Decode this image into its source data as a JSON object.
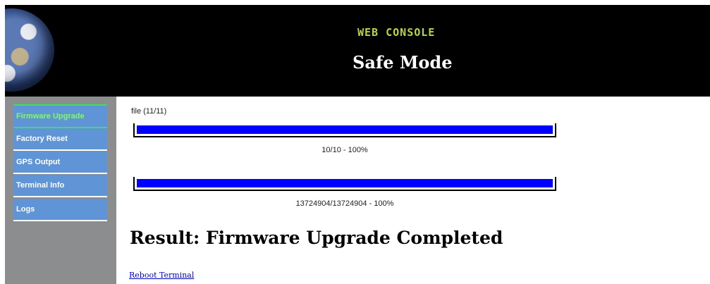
{
  "header": {
    "logo_icon": "globe-icon",
    "console_title": "WEB CONSOLE",
    "mode_title": "Safe Mode",
    "background_color": "#000000",
    "console_title_color": "#b7d63c"
  },
  "sidebar": {
    "items": [
      {
        "label": "Firmware Upgrade",
        "active": true
      },
      {
        "label": "Factory Reset",
        "active": false
      },
      {
        "label": "GPS Output",
        "active": false
      },
      {
        "label": "Terminal Info",
        "active": false
      },
      {
        "label": "Logs",
        "active": false
      }
    ],
    "item_color": "#5f95d6",
    "active_text_color": "#7cff57"
  },
  "main": {
    "file_label": "file (11/11)",
    "progress": [
      {
        "fraction": 1.0,
        "caption": "10/10 - 100%"
      },
      {
        "fraction": 1.0,
        "caption": "13724904/13724904 - 100%"
      }
    ],
    "bar_color": "#0000ff",
    "result": "Result: Firmware Upgrade Completed",
    "reboot_link": "Reboot Terminal"
  }
}
